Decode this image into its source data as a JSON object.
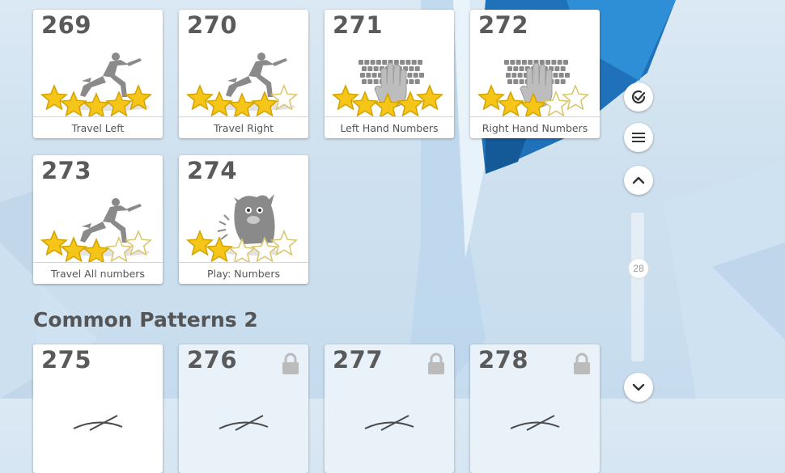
{
  "levels": [
    {
      "number": "269",
      "label": "Travel Left",
      "stars": 5,
      "art": "runner-icon",
      "locked": false
    },
    {
      "number": "270",
      "label": "Travel Right",
      "stars": 4,
      "art": "runner-icon",
      "locked": false
    },
    {
      "number": "271",
      "label": "Left Hand Numbers",
      "stars": 5,
      "art": "keyboard-hand-icon",
      "locked": false
    },
    {
      "number": "272",
      "label": "Right Hand Numbers",
      "stars": 3,
      "art": "keyboard-hand-icon",
      "locked": false
    },
    {
      "number": "273",
      "label": "Travel All numbers",
      "stars": 3,
      "art": "runner-icon",
      "locked": false
    },
    {
      "number": "274",
      "label": "Play: Numbers",
      "stars": 2,
      "art": "monster-icon",
      "locked": false
    }
  ],
  "section": {
    "title": "Common Patterns 2"
  },
  "section_levels": [
    {
      "number": "275",
      "locked": false
    },
    {
      "number": "276",
      "locked": true
    },
    {
      "number": "277",
      "locked": true
    },
    {
      "number": "278",
      "locked": true
    }
  ],
  "sidebar": {
    "check_icon": "check-circle-icon",
    "menu_icon": "hamburger-menu-icon",
    "up_icon": "chevron-up-icon",
    "down_icon": "chevron-down-icon",
    "slider_value": "28"
  },
  "colors": {
    "star_fill": "#f5c518",
    "text": "#555555",
    "accent_blue": "#1d6fb8"
  }
}
